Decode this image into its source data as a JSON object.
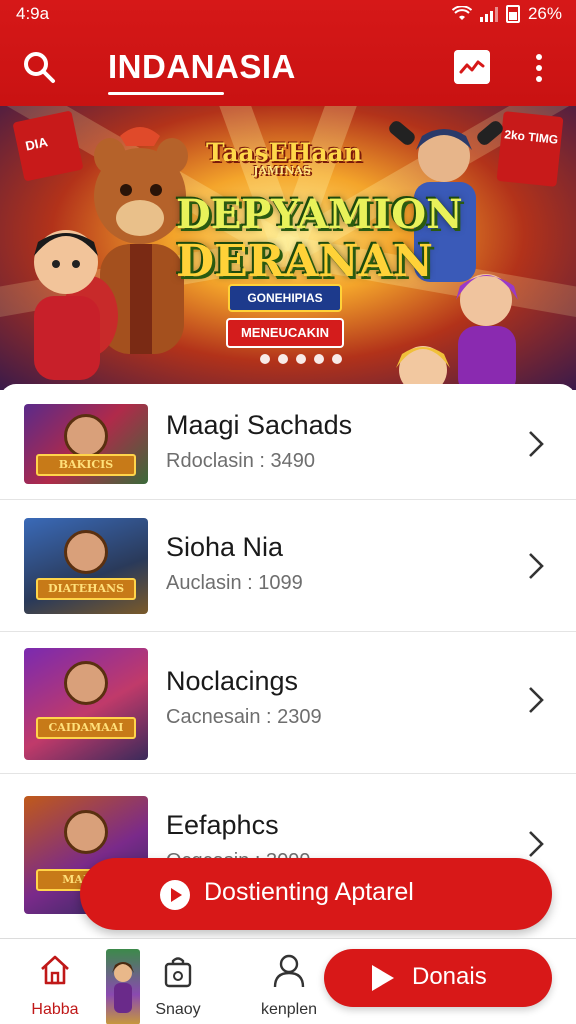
{
  "status_bar": {
    "time": "4:9a",
    "battery": "26%"
  },
  "app_bar": {
    "title": "INDANASIA"
  },
  "banner": {
    "small_title": "TaasEHaan",
    "small_title_sub": "JAMINAS",
    "main_title_line1": "DEPYAMION",
    "main_title_line2": "DERANAN",
    "left_flag_text": "DIA",
    "right_flag_text": "2ko TIMG",
    "blue_button_label": "GONEHIPIAS",
    "red_button_label": "MENEUCAKIN",
    "slide_count": 5
  },
  "list": {
    "items": [
      {
        "title": "Maagi Sachads",
        "subtitle": "Rdoclasin : 3490",
        "thumb_label": "BAKICIS"
      },
      {
        "title": "Sioha Nia",
        "subtitle": "Auclasin : 1099",
        "thumb_label": "DIATEHANS"
      },
      {
        "title": "Noclacings",
        "subtitle": "Cacnesain : 2309",
        "thumb_label": "CAIDAMAAI"
      },
      {
        "title": "Eefaphcs",
        "subtitle": "Ocgcasin : 3099",
        "thumb_label": "MAIIAS"
      }
    ]
  },
  "fab": {
    "label": "Dostienting Aptarel"
  },
  "bottom_nav": {
    "items": [
      {
        "label": "Habba",
        "icon": "home-icon"
      },
      {
        "label": "Snaoy",
        "icon": "bag-icon"
      },
      {
        "label": "kenplen",
        "icon": "person-icon"
      }
    ],
    "donate_label": "Donais"
  },
  "colors": {
    "primary_red": "#d81818",
    "text_dark": "#1a1a1a",
    "text_muted": "#6e6e6e"
  }
}
